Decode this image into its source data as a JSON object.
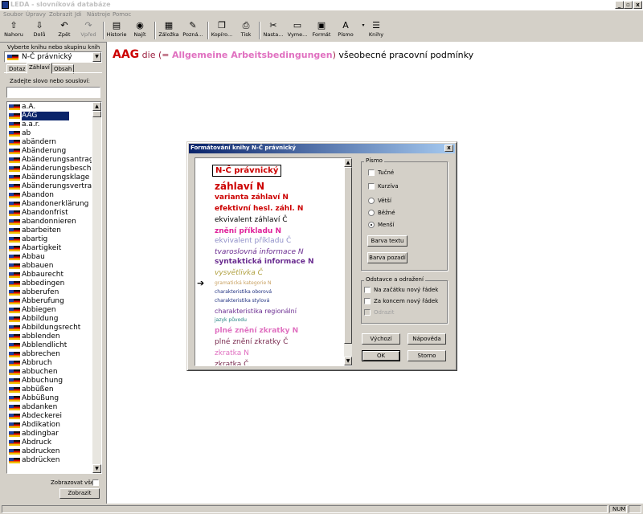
{
  "window": {
    "title": "LEDA - slovníková databáze"
  },
  "menu": [
    "Soubor",
    "Úpravy",
    "Zobrazit",
    "Jdi",
    "Nástroje",
    "Pomoc"
  ],
  "toolbar": [
    {
      "label": "Nahoru",
      "icon": "arrow-up-icon"
    },
    {
      "label": "Dolů",
      "icon": "arrow-down-icon"
    },
    {
      "label": "Zpět",
      "icon": "back-icon"
    },
    {
      "label": "Vpřed",
      "icon": "forward-icon"
    },
    {
      "label": "Historie",
      "icon": "history-icon"
    },
    {
      "label": "Najít",
      "icon": "find-icon"
    },
    {
      "label": "Záložka",
      "icon": "bookmark-icon"
    },
    {
      "label": "Pozná...",
      "icon": "note-icon"
    },
    {
      "label": "Kopíro...",
      "icon": "copy-icon"
    },
    {
      "label": "Tisk",
      "icon": "print-icon"
    },
    {
      "label": "Nasta...",
      "icon": "tools-icon"
    },
    {
      "label": "Vyme...",
      "icon": "clear-icon"
    },
    {
      "label": "Formát",
      "icon": "format-icon"
    },
    {
      "label": "Písmo",
      "icon": "font-icon"
    },
    {
      "label": "Knihy",
      "icon": "books-icon"
    }
  ],
  "left": {
    "group_label": "Vyberte knihu nebo skupinu knih",
    "selected_collection": "N-Č právnický",
    "tabs": [
      "Dotaz",
      "Záhlaví",
      "Obsah"
    ],
    "search_label": "Zadejte slovo nebo sousloví:",
    "search_value": "",
    "words": [
      "a.A.",
      "AAG",
      "a.a.r.",
      "ab",
      "abändern",
      "Abänderung",
      "Abänderungsantrag",
      "Abänderungsbeschluss",
      "Abänderungsklage",
      "Abänderungsvertrag",
      "Abandon",
      "Abandonerklärung",
      "Abandonfrist",
      "abandonnieren",
      "abarbeiten",
      "abartig",
      "Abartigkeit",
      "Abbau",
      "abbauen",
      "Abbaurecht",
      "abbedingen",
      "abberufen",
      "Abberufung",
      "Abbiegen",
      "Abbildung",
      "Abbildungsrecht",
      "abblenden",
      "Abblendlicht",
      "abbrechen",
      "Abbruch",
      "abbuchen",
      "Abbuchung",
      "abbüßen",
      "Abbüßung",
      "abdanken",
      "Abdeckerei",
      "Abdikation",
      "abdingbar",
      "Abdruck",
      "abdrucken",
      "abdrücken"
    ],
    "selected_word": "AAG",
    "show_all_label": "Zobrazovat vše",
    "show_button": "Zobrazit"
  },
  "entry": {
    "headword": "AAG",
    "article": "die",
    "open_paren": "(=",
    "expansion": "Allgemeine Arbeitsbedingungen",
    "close_paren": ")",
    "translation": "všeobecné pracovní podmínky"
  },
  "dialog": {
    "title": "Formátování knihy N-Č právnický",
    "preview": [
      {
        "text": "N-Č právnický",
        "color": "#cc0000",
        "size": 10,
        "weight": "bold",
        "style": "normal",
        "boxed": true
      },
      {
        "text": "záhlaví N",
        "color": "#cc0000",
        "size": 12,
        "weight": "bold",
        "style": "normal"
      },
      {
        "text": "varianta záhlaví N",
        "color": "#cc0000",
        "size": 9,
        "weight": "bold",
        "style": "normal"
      },
      {
        "text": "efektivní hesl. záhl. N",
        "color": "#cc0000",
        "size": 9,
        "weight": "bold",
        "style": "normal"
      },
      {
        "text": "ekvivalent záhlaví Č",
        "color": "#000000",
        "size": 9,
        "weight": "normal",
        "style": "normal"
      },
      {
        "text": "znění příkladu N",
        "color": "#e0219a",
        "size": 9,
        "weight": "bold",
        "style": "normal"
      },
      {
        "text": "ekvivalent příkladu Č",
        "color": "#8f8fc8",
        "size": 9,
        "weight": "normal",
        "style": "normal"
      },
      {
        "text": "tvaroslovná informace N",
        "color": "#6a2c90",
        "size": 9,
        "weight": "normal",
        "style": "italic"
      },
      {
        "text": "syntaktická informace N",
        "color": "#6a2c90",
        "size": 9,
        "weight": "bold",
        "style": "normal"
      },
      {
        "text": "vysvětlivka Č",
        "color": "#b0a040",
        "size": 9,
        "weight": "normal",
        "style": "italic"
      },
      {
        "text": "gramatická kategorie N",
        "color": "#c8a060",
        "size": 6,
        "weight": "normal",
        "style": "normal"
      },
      {
        "text": "charakteristika oborová",
        "color": "#1e2f80",
        "size": 6,
        "weight": "normal",
        "style": "normal"
      },
      {
        "text": "charakteristika stylová",
        "color": "#1e2f80",
        "size": 6,
        "weight": "normal",
        "style": "normal"
      },
      {
        "text": "charakteristika regionální",
        "color": "#6a2c90",
        "size": 8,
        "weight": "normal",
        "style": "normal"
      },
      {
        "text": "jazyk původu",
        "color": "#1e8080",
        "size": 6,
        "weight": "normal",
        "style": "normal"
      },
      {
        "text": "plné znění zkratky N",
        "color": "#e070c0",
        "size": 9,
        "weight": "bold",
        "style": "normal"
      },
      {
        "text": "plné znění zkratky Č",
        "color": "#7a2c50",
        "size": 9,
        "weight": "normal",
        "style": "normal"
      },
      {
        "text": "zkratka N",
        "color": "#e070c0",
        "size": 9,
        "weight": "normal",
        "style": "normal"
      },
      {
        "text": "zkratka Č",
        "color": "#7a2c50",
        "size": 9,
        "weight": "normal",
        "style": "normal"
      },
      {
        "text": "...",
        "color": "#b0b0b0",
        "size": 8,
        "weight": "normal",
        "style": "normal"
      }
    ],
    "font_group": "Písmo",
    "bold_label": "Tučné",
    "italic_label": "Kurzíva",
    "bigger_label": "Větší",
    "normal_label": "Běžné",
    "smaller_label": "Menší",
    "text_color_button": "Barva textu",
    "bg_color_button": "Barva pozadí",
    "para_group": "Odstavce a odražení",
    "newline_start_label": "Na začátku nový řádek",
    "newline_end_label": "Za koncem nový řádek",
    "indent_label": "Odrazit",
    "default_button": "Výchozí",
    "help_button": "Nápověda",
    "ok_button": "OK",
    "cancel_button": "Storno"
  },
  "status": {
    "num": "NUM"
  }
}
